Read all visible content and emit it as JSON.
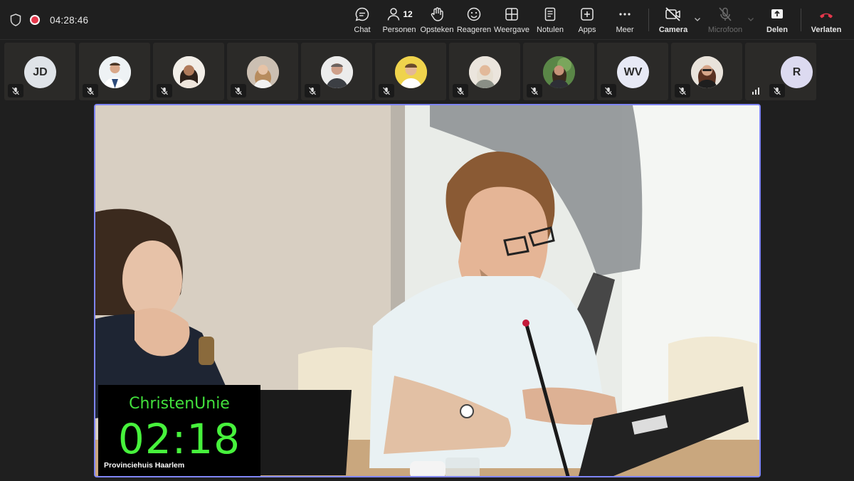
{
  "meeting": {
    "elapsed": "04:28:46",
    "participants_count": "12"
  },
  "toolbar": {
    "chat": "Chat",
    "people": "Personen",
    "raise_hand": "Opsteken",
    "react": "Reageren",
    "view": "Weergave",
    "notes": "Notulen",
    "apps": "Apps",
    "more": "Meer",
    "camera": "Camera",
    "microphone": "Microfoon",
    "share": "Delen",
    "leave": "Verlaten"
  },
  "participants": [
    {
      "initials": "JD",
      "muted": true,
      "type": "initials",
      "color": "#dfe3e8"
    },
    {
      "initials": "",
      "muted": true,
      "type": "photo"
    },
    {
      "initials": "",
      "muted": true,
      "type": "photo"
    },
    {
      "initials": "",
      "muted": true,
      "type": "photo"
    },
    {
      "initials": "",
      "muted": true,
      "type": "photo"
    },
    {
      "initials": "",
      "muted": true,
      "type": "photo"
    },
    {
      "initials": "",
      "muted": true,
      "type": "photo"
    },
    {
      "initials": "",
      "muted": true,
      "type": "photo"
    },
    {
      "initials": "WV",
      "muted": true,
      "type": "initials",
      "color": "#e7e9f5"
    },
    {
      "initials": "",
      "muted": true,
      "type": "photo"
    },
    {
      "initials": "R",
      "muted": true,
      "type": "initials",
      "color": "#dcdaf0"
    }
  ],
  "stage": {
    "party": "ChristenUnie",
    "speaking_time": "02:18",
    "location": "Provinciehuis Haarlem"
  },
  "colors": {
    "accent": "#7f85f5",
    "leave": "#e5374b",
    "timer_green": "#47f23c"
  }
}
